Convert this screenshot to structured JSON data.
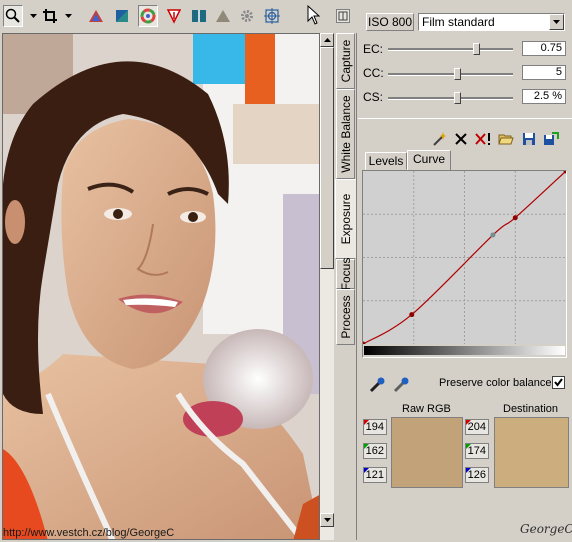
{
  "toolbar": {
    "tools": [
      "zoom-icon",
      "crop-icon",
      "exposure-icon",
      "color-balance-icon",
      "color-wheel-icon",
      "white-balance-icon",
      "compare-icon",
      "triangle-icon",
      "gear-icon",
      "target-icon"
    ]
  },
  "photo": {
    "watermark": "http://www.vestch.cz/blog/GeorgeC",
    "signature": "GeorgeC"
  },
  "tabs": {
    "vertical": [
      "Capture",
      "White Balance",
      "Exposure",
      "Focus",
      "Process"
    ],
    "active": "Exposure",
    "curve_tabs": [
      "Levels",
      "Curve"
    ],
    "active_curve_tab": "Curve"
  },
  "iso": {
    "label": "ISO 800",
    "profile": "Film standard"
  },
  "sliders": [
    {
      "label": "EC:",
      "value": "0.75",
      "fraction": 0.7
    },
    {
      "label": "CC:",
      "value": "5",
      "fraction": 0.55
    },
    {
      "label": "CS:",
      "value": "2.5 %",
      "fraction": 0.55
    }
  ],
  "curve": {
    "points": [
      [
        0,
        0
      ],
      [
        0.24,
        0.17
      ],
      [
        0.64,
        0.63
      ],
      [
        0.75,
        0.73
      ],
      [
        1,
        1
      ]
    ]
  },
  "preserve": {
    "label": "Preserve color balance",
    "checked": true
  },
  "readout": {
    "raw_label": "Raw RGB",
    "dest_label": "Destination",
    "raw": [
      "194",
      "162",
      "121"
    ],
    "dest": [
      "204",
      "174",
      "126"
    ],
    "raw_color": "#c2a279",
    "dest_color": "#ccae7e"
  },
  "colors": {
    "panel": "#d4d0c8",
    "curve": "#b00000",
    "grid": "#a0a0a0",
    "curve_bg": "#d0d0d0"
  }
}
